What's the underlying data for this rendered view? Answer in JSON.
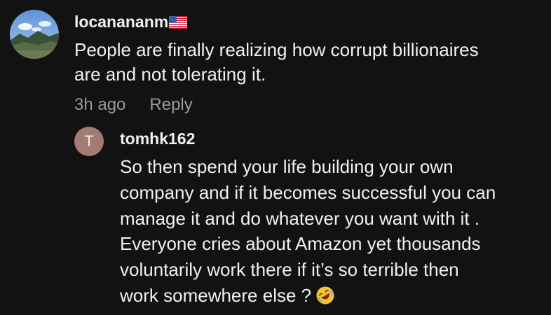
{
  "comment": {
    "username": "locanananm",
    "flag_icon": "us-flag-icon",
    "avatar_icon": "mountain-landscape-avatar",
    "body_lines": [
      "People are finally realizing how corrupt billionaires",
      "are and not tolerating it."
    ],
    "timestamp": "3h ago",
    "reply_label": "Reply"
  },
  "reply": {
    "avatar_letter": "T",
    "avatar_color": "#a47a74",
    "username": "tomhk162",
    "body_lines": [
      "So then spend your life building your own",
      "company and if it becomes successful you can",
      "manage it and do whatever you want with it .",
      "Everyone cries about Amazon yet thousands",
      "voluntarily work there if it’s so terrible then",
      "work somewhere else ?"
    ],
    "emoji_icon": "rolling-on-floor-laughing-emoji"
  },
  "colors": {
    "background": "#121212",
    "text": "#f1f1f1",
    "muted": "#9a9a9a"
  }
}
